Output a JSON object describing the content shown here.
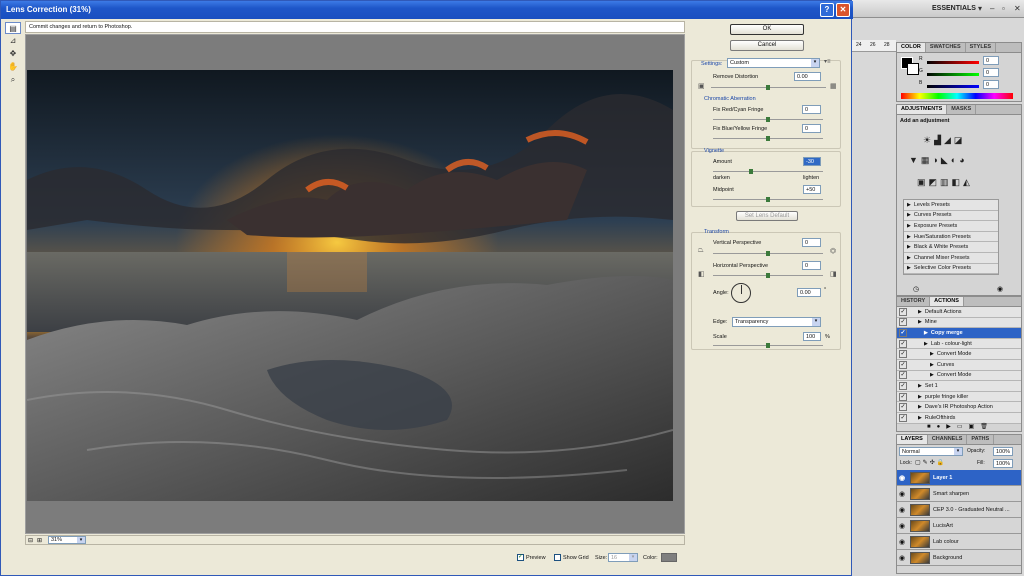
{
  "dialog": {
    "title": "Lens Correction (31%)",
    "hint": "Commit changes and return to Photoshop.",
    "ok_label": "OK",
    "cancel_label": "Cancel",
    "settings_label": "Settings:",
    "settings_value": "Custom",
    "remove_distortion_label": "Remove Distortion",
    "remove_distortion_value": "0.00",
    "chromatic_title": "Chromatic Aberration",
    "fix_red_label": "Fix Red/Cyan Fringe",
    "fix_red_value": "0",
    "fix_blue_label": "Fix Blue/Yellow Fringe",
    "fix_blue_value": "0",
    "vignette_title": "Vignette",
    "amount_label": "Amount",
    "amount_value": "-30",
    "darken_label": "darken",
    "lighten_label": "lighten",
    "midpoint_label": "Midpoint",
    "midpoint_value": "+50",
    "set_lens_default_label": "Set Lens Default",
    "transform_title": "Transform",
    "vertical_label": "Vertical Perspective",
    "vertical_value": "0",
    "horizontal_label": "Horizontal Perspective",
    "horizontal_value": "0",
    "angle_label": "Angle:",
    "angle_value": "0.00",
    "degree": "°",
    "edge_label": "Edge:",
    "edge_value": "Transparency",
    "scale_label": "Scale",
    "scale_value": "100",
    "percent": "%",
    "zoom_value": "31%",
    "preview_label": "Preview",
    "show_grid_label": "Show Grid",
    "size_label": "Size:",
    "size_value": "16",
    "color_label": "Color:",
    "grid_color": "#7f7f7f"
  },
  "photoshop": {
    "essentials_label": "ESSENTIALS",
    "color_tabs": [
      "COLOR",
      "SWATCHES",
      "STYLES"
    ],
    "color_rows": [
      {
        "label": "R",
        "value": "0"
      },
      {
        "label": "G",
        "value": "0"
      },
      {
        "label": "B",
        "value": "0"
      }
    ],
    "adjust_tabs": [
      "ADJUSTMENTS",
      "MASKS"
    ],
    "adjust_title": "Add an adjustment",
    "presets": [
      "Levels Presets",
      "Curves Presets",
      "Exposure Presets",
      "Hue/Saturation Presets",
      "Black & White Presets",
      "Channel Mixer Presets",
      "Selective Color Presets"
    ],
    "actions_tabs": [
      "HISTORY",
      "ACTIONS"
    ],
    "actions": [
      {
        "label": "Default Actions",
        "sel": false
      },
      {
        "label": "Mine",
        "sel": false
      },
      {
        "label": "Copy merge",
        "sel": true
      },
      {
        "label": "Lab - colour-light",
        "sel": false
      },
      {
        "label": "Convert Mode",
        "sel": false
      },
      {
        "label": "Curves",
        "sel": false
      },
      {
        "label": "Convert Mode",
        "sel": false
      },
      {
        "label": "Set 1",
        "sel": false
      },
      {
        "label": "purple fringe killer",
        "sel": false
      },
      {
        "label": "Dave's IR Photoshop Action",
        "sel": false
      },
      {
        "label": "RuleOfthirds",
        "sel": false
      }
    ],
    "layers_tabs": [
      "LAYERS",
      "CHANNELS",
      "PATHS"
    ],
    "blend_mode": "Normal",
    "opacity_label": "Opacity:",
    "opacity_value": "100%",
    "lock_label": "Lock:",
    "fill_label": "Fill:",
    "fill_value": "100%",
    "layers": [
      {
        "label": "Layer 1",
        "sel": true
      },
      {
        "label": "Smart sharpen",
        "sel": false
      },
      {
        "label": "CEP 3.0 - Graduated Neutral ...",
        "sel": false
      },
      {
        "label": "LucisArt",
        "sel": false
      },
      {
        "label": "Lab colour",
        "sel": false
      },
      {
        "label": "Background",
        "sel": false
      }
    ],
    "ruler_marks": [
      "24",
      "26",
      "28"
    ]
  }
}
